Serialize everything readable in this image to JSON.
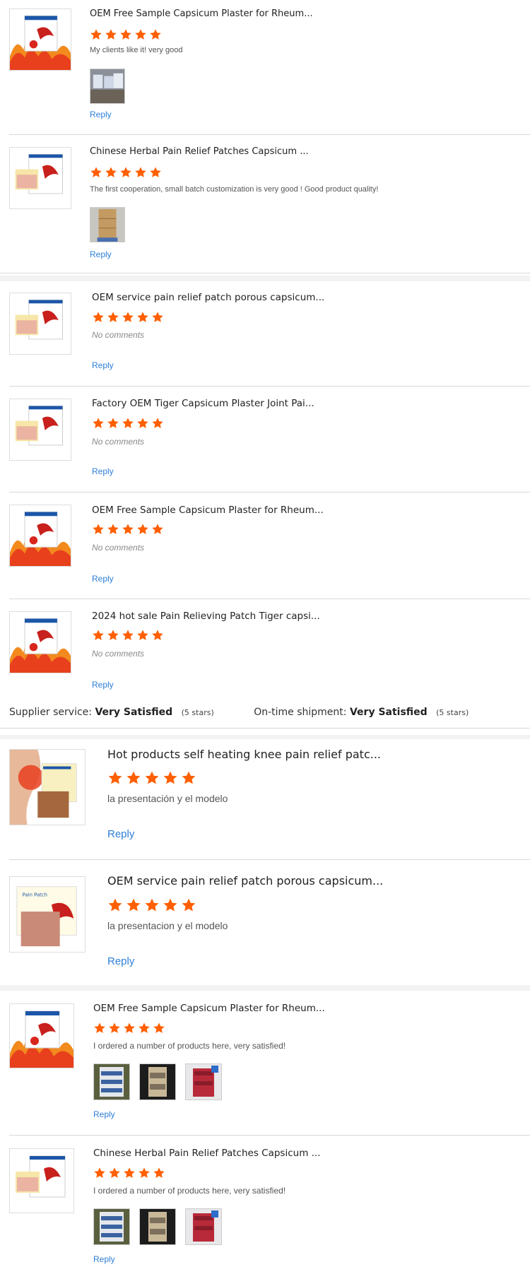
{
  "accent_star": "#ff5f00",
  "link_color": "#2d7fd8",
  "reply_label": "Reply",
  "reviews": [
    {
      "title": "OEM Free Sample Capsicum Plaster for Rheum...",
      "stars": 5,
      "comment": "My clients like it! very good",
      "thumb": "fire-box",
      "photos": [
        "boxes-photo"
      ]
    },
    {
      "title": "Chinese Herbal Pain Relief Patches Capsicum ...",
      "stars": 5,
      "comment": "The first cooperation, small batch customization is very good !  Good product quality!",
      "thumb": "box-patch",
      "photos": [
        "carton-photo"
      ]
    },
    {
      "title": "OEM service pain relief patch porous capsicum...",
      "stars": 5,
      "comment": "No comments",
      "thumb": "box-patch",
      "photos": []
    },
    {
      "title": "Factory OEM Tiger Capsicum Plaster Joint Pai...",
      "stars": 5,
      "comment": "No comments",
      "thumb": "box-patch",
      "photos": []
    },
    {
      "title": "OEM Free Sample Capsicum Plaster for Rheum...",
      "stars": 5,
      "comment": "No comments",
      "thumb": "fire-box",
      "photos": []
    },
    {
      "title": "2024 hot sale Pain Relieving Patch Tiger capsi...",
      "stars": 5,
      "comment": "No comments",
      "thumb": "fire-box",
      "photos": []
    },
    {
      "title": "Hot products self heating knee pain relief patc...",
      "stars": 5,
      "comment": "la presentación y el modelo",
      "thumb": "knee-patch",
      "photos": []
    },
    {
      "title": "OEM service pain relief patch porous capsicum...",
      "stars": 5,
      "comment": "la presentacion y el modelo",
      "thumb": "pain-patch-box",
      "photos": []
    },
    {
      "title": "OEM Free Sample Capsicum Plaster for Rheum...",
      "stars": 5,
      "comment": "I ordered a number of products here,  very satisfied!",
      "thumb": "fire-box",
      "photos": [
        "box-photo-a",
        "box-photo-b",
        "red-box-photo"
      ]
    },
    {
      "title": "Chinese Herbal Pain Relief Patches Capsicum ...",
      "stars": 5,
      "comment": "I ordered a number of products here,  very satisfied!",
      "thumb": "box-patch",
      "photos": [
        "box-photo-a",
        "box-photo-b",
        "red-box-photo"
      ]
    }
  ],
  "ratings": {
    "supplier_label": "Supplier service:",
    "supplier_value": "Very Satisfied",
    "supplier_stars": "(5 stars)",
    "shipment_label": "On-time shipment:",
    "shipment_value": "Very Satisfied",
    "shipment_stars": "(5 stars)"
  }
}
